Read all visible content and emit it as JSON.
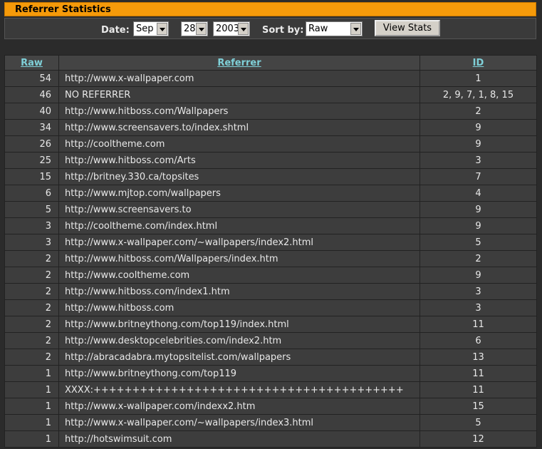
{
  "title": "Referrer Statistics",
  "controls": {
    "date_label": "Date:",
    "month": "Sep",
    "day": "28",
    "year": "2003",
    "sort_label": "Sort by:",
    "sort_value": "Raw",
    "view_button": "View Stats"
  },
  "table": {
    "headers": [
      "Raw",
      "Referrer",
      "ID"
    ],
    "rows": [
      [
        "54",
        "http://www.x-wallpaper.com",
        "1"
      ],
      [
        "46",
        "NO REFERRER",
        "2, 9, 7, 1, 8, 15"
      ],
      [
        "40",
        "http://www.hitboss.com/Wallpapers",
        "2"
      ],
      [
        "34",
        "http://www.screensavers.to/index.shtml",
        "9"
      ],
      [
        "26",
        "http://cooltheme.com",
        "9"
      ],
      [
        "25",
        "http://www.hitboss.com/Arts",
        "3"
      ],
      [
        "15",
        "http://britney.330.ca/topsites",
        "7"
      ],
      [
        "6",
        "http://www.mjtop.com/wallpapers",
        "4"
      ],
      [
        "5",
        "http://www.screensavers.to",
        "9"
      ],
      [
        "3",
        "http://cooltheme.com/index.html",
        "9"
      ],
      [
        "3",
        "http://www.x-wallpaper.com/~wallpapers/index2.html",
        "5"
      ],
      [
        "2",
        "http://www.hitboss.com/Wallpapers/index.htm",
        "2"
      ],
      [
        "2",
        "http://www.cooltheme.com",
        "9"
      ],
      [
        "2",
        "http://www.hitboss.com/index1.htm",
        "3"
      ],
      [
        "2",
        "http://www.hitboss.com",
        "3"
      ],
      [
        "2",
        "http://www.britneythong.com/top119/index.html",
        "11"
      ],
      [
        "2",
        "http://www.desktopcelebrities.com/index2.htm",
        "6"
      ],
      [
        "2",
        "http://abracadabra.mytopsitelist.com/wallpapers",
        "13"
      ],
      [
        "1",
        "http://www.britneythong.com/top119",
        "11"
      ],
      [
        "1",
        "XXXX:++++++++++++++++++++++++++++++++++++++++",
        "11"
      ],
      [
        "1",
        "http://www.x-wallpaper.com/indexx2.htm",
        "15"
      ],
      [
        "1",
        "http://www.x-wallpaper.com/~wallpapers/index3.html",
        "5"
      ],
      [
        "1",
        "http://hotswimsuit.com",
        "12"
      ]
    ]
  }
}
